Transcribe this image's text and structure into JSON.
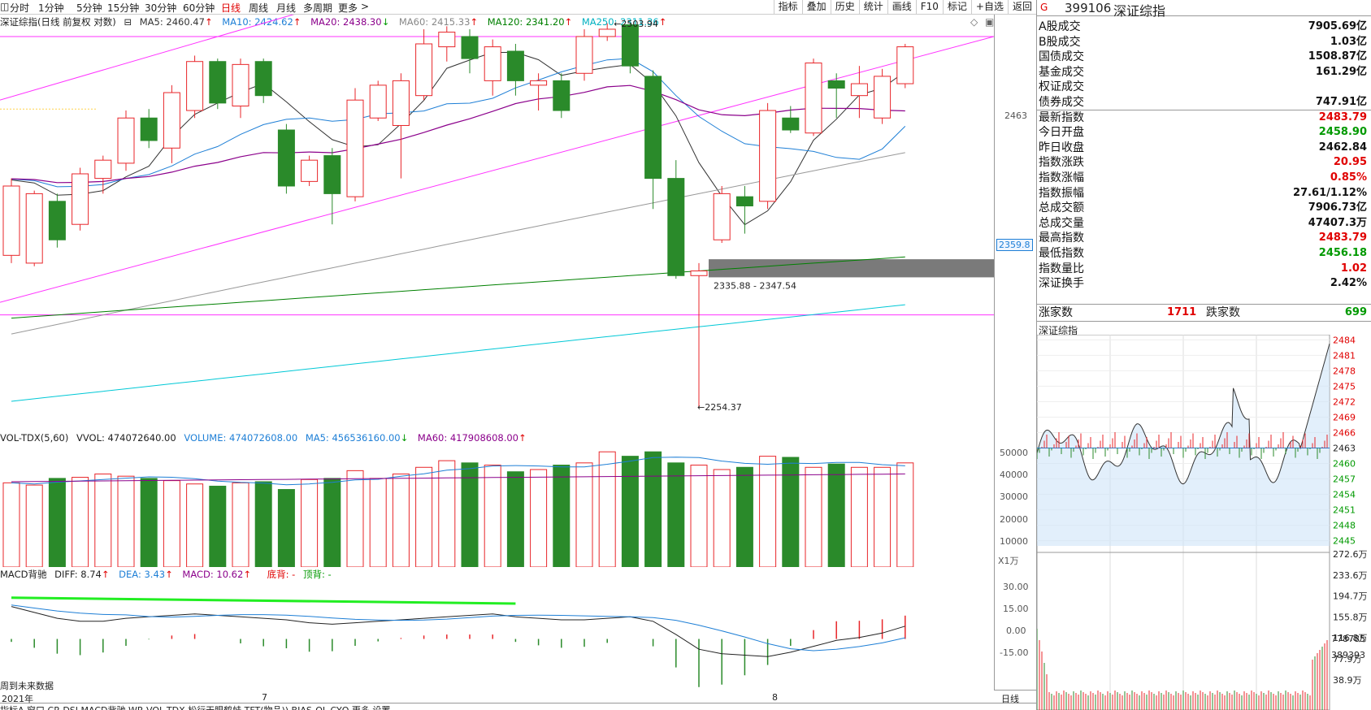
{
  "toolbar": {
    "periods": [
      "分时",
      "1分钟",
      "5分钟",
      "15分钟",
      "30分钟",
      "60分钟",
      "日线",
      "周线",
      "月线",
      "多周期",
      "更多"
    ],
    "active_period": "日线",
    "tools": [
      "指标",
      "叠加",
      "历史",
      "统计",
      "画线",
      "F10",
      "标记",
      "+自选",
      "返回"
    ]
  },
  "kline_header": {
    "title": "深证综指(日线 前复权 对数)",
    "ma5": "MA5: 2460.47",
    "ma10": "MA10: 2424.62",
    "ma20": "MA20: 2438.30",
    "ma60": "MA60: 2415.33",
    "ma120": "MA120: 2341.20",
    "ma250": "MA250: 2311.36",
    "colors": {
      "ma5": "#333333",
      "ma10": "#1e7fd6",
      "ma20": "#8b008b",
      "ma60": "#888888",
      "ma120": "#008000",
      "ma250": "#00b0c0"
    }
  },
  "kline_annotations": {
    "high_label": "2503.94",
    "low_label": "2254.37",
    "gap_range": "2335.88 - 2347.54",
    "axis_current": "2463",
    "axis_marker": "2359.8"
  },
  "vol_header": {
    "title": "VOL-TDX(5,60)",
    "vvol": "VVOL: 474072640.00",
    "volume": "VOLUME: 474072608.00",
    "ma5": "MA5: 456536160.00",
    "ma60": "MA60: 417908608.00",
    "ticks": [
      "50000",
      "40000",
      "30000",
      "20000",
      "10000"
    ],
    "unit": "X1万"
  },
  "macd_header": {
    "title": "MACD背驰",
    "diff": "DIFF: 8.74",
    "dea": "DEA: 3.43",
    "macd": "MACD: 10.62",
    "bottom_div": "底背: -",
    "top_div": "顶背: -",
    "ticks": [
      "30.00",
      "15.00",
      "0.00",
      "-15.00"
    ]
  },
  "bottom": {
    "future_data": "周到未来数据",
    "year": "2021年",
    "month7": "7",
    "month8": "8",
    "period_label": "日线",
    "tabs": "指标A 窗口 CR DSI MACD背驰 WR VOL-TDX 松行天眼鹤蛙 TFT(物品)) BIAS-QL CYQ 更多 设置"
  },
  "quote": {
    "code": "399106",
    "name": "深证综指",
    "tag": "G",
    "rows": [
      {
        "label": "A股成交",
        "value": "7905.69亿",
        "color": "blk"
      },
      {
        "label": "B股成交",
        "value": "1.03亿",
        "color": "blk"
      },
      {
        "label": "国债成交",
        "value": "1508.87亿",
        "color": "blk"
      },
      {
        "label": "基金成交",
        "value": "161.29亿",
        "color": "blk"
      },
      {
        "label": "权证成交",
        "value": "",
        "color": "blk"
      },
      {
        "label": "债券成交",
        "value": "747.91亿",
        "color": "blk"
      },
      {
        "label": "最新指数",
        "value": "2483.79",
        "color": "red"
      },
      {
        "label": "今日开盘",
        "value": "2458.90",
        "color": "green"
      },
      {
        "label": "昨日收盘",
        "value": "2462.84",
        "color": "blk"
      },
      {
        "label": "指数涨跌",
        "value": "20.95",
        "color": "red"
      },
      {
        "label": "指数涨幅",
        "value": "0.85%",
        "color": "red"
      },
      {
        "label": "指数振幅",
        "value": "27.61/1.12%",
        "color": "blk"
      },
      {
        "label": "总成交额",
        "value": "7906.73亿",
        "color": "blk"
      },
      {
        "label": "总成交量",
        "value": "47407.3万",
        "color": "blk"
      },
      {
        "label": "最高指数",
        "value": "2483.79",
        "color": "red"
      },
      {
        "label": "最低指数",
        "value": "2456.18",
        "color": "green"
      },
      {
        "label": "指数量比",
        "value": "1.02",
        "color": "red"
      },
      {
        "label": "深证换手",
        "value": "2.42%",
        "color": "blk"
      }
    ],
    "rise_label": "涨家数",
    "rise_value": "1711",
    "fall_label": "跌家数",
    "fall_value": "699"
  },
  "intraday": {
    "title": "深证综指",
    "price_ticks": [
      "2484",
      "2481",
      "2478",
      "2475",
      "2472",
      "2469",
      "2466",
      "2463",
      "2460",
      "2457",
      "2454",
      "2451",
      "2448",
      "2445"
    ],
    "vol_ticks": [
      "272.6万",
      "233.6万",
      "194.7万",
      "155.8万",
      "116.8万",
      "77.9万",
      "38.9万"
    ],
    "vol_axis": [
      "778785",
      "389393"
    ]
  },
  "chart_data": {
    "type": "candlestick",
    "note_series": "daily OHLC approximated",
    "candles": [
      {
        "o": 2350,
        "c": 2395,
        "h": 2400,
        "l": 2345
      },
      {
        "o": 2345,
        "c": 2390,
        "h": 2392,
        "l": 2343
      },
      {
        "o": 2385,
        "c": 2360,
        "h": 2390,
        "l": 2355
      },
      {
        "o": 2370,
        "c": 2403,
        "h": 2407,
        "l": 2366
      },
      {
        "o": 2400,
        "c": 2412,
        "h": 2415,
        "l": 2390
      },
      {
        "o": 2410,
        "c": 2440,
        "h": 2445,
        "l": 2405
      },
      {
        "o": 2440,
        "c": 2425,
        "h": 2446,
        "l": 2420
      },
      {
        "o": 2420,
        "c": 2457,
        "h": 2462,
        "l": 2410
      },
      {
        "o": 2445,
        "c": 2478,
        "h": 2482,
        "l": 2440
      },
      {
        "o": 2478,
        "c": 2450,
        "h": 2480,
        "l": 2446
      },
      {
        "o": 2448,
        "c": 2476,
        "h": 2480,
        "l": 2440
      },
      {
        "o": 2478,
        "c": 2455,
        "h": 2480,
        "l": 2450
      },
      {
        "o": 2432,
        "c": 2395,
        "h": 2436,
        "l": 2390
      },
      {
        "o": 2398,
        "c": 2412,
        "h": 2415,
        "l": 2395
      },
      {
        "o": 2415,
        "c": 2390,
        "h": 2420,
        "l": 2370
      },
      {
        "o": 2388,
        "c": 2452,
        "h": 2460,
        "l": 2385
      },
      {
        "o": 2440,
        "c": 2462,
        "h": 2465,
        "l": 2438
      },
      {
        "o": 2435,
        "c": 2465,
        "h": 2470,
        "l": 2400
      },
      {
        "o": 2455,
        "c": 2490,
        "h": 2500,
        "l": 2452
      },
      {
        "o": 2488,
        "c": 2498,
        "h": 2502,
        "l": 2478
      },
      {
        "o": 2495,
        "c": 2480,
        "h": 2500,
        "l": 2470
      },
      {
        "o": 2465,
        "c": 2488,
        "h": 2493,
        "l": 2455
      },
      {
        "o": 2485,
        "c": 2465,
        "h": 2490,
        "l": 2455
      },
      {
        "o": 2462,
        "c": 2465,
        "h": 2470,
        "l": 2445
      },
      {
        "o": 2465,
        "c": 2445,
        "h": 2470,
        "l": 2440
      },
      {
        "o": 2470,
        "c": 2495,
        "h": 2500,
        "l": 2465
      },
      {
        "o": 2495,
        "c": 2500,
        "h": 2504,
        "l": 2492
      },
      {
        "o": 2503,
        "c": 2475,
        "h": 2504,
        "l": 2470
      },
      {
        "o": 2468,
        "c": 2400,
        "h": 2472,
        "l": 2380
      },
      {
        "o": 2400,
        "c": 2337,
        "h": 2412,
        "l": 2335
      },
      {
        "o": 2337,
        "c": 2340,
        "h": 2345,
        "l": 2254
      },
      {
        "o": 2360,
        "c": 2390,
        "h": 2395,
        "l": 2358
      },
      {
        "o": 2388,
        "c": 2382,
        "h": 2395,
        "l": 2364
      },
      {
        "o": 2385,
        "c": 2445,
        "h": 2450,
        "l": 2380
      },
      {
        "o": 2440,
        "c": 2432,
        "h": 2448,
        "l": 2430
      },
      {
        "o": 2430,
        "c": 2477,
        "h": 2480,
        "l": 2428
      },
      {
        "o": 2465,
        "c": 2460,
        "h": 2470,
        "l": 2440
      },
      {
        "o": 2455,
        "c": 2463,
        "h": 2475,
        "l": 2440
      },
      {
        "o": 2440,
        "c": 2468,
        "h": 2473,
        "l": 2436
      },
      {
        "o": 2463,
        "c": 2488,
        "h": 2490,
        "l": 2460
      }
    ],
    "y_range": [
      2240,
      2510
    ]
  }
}
